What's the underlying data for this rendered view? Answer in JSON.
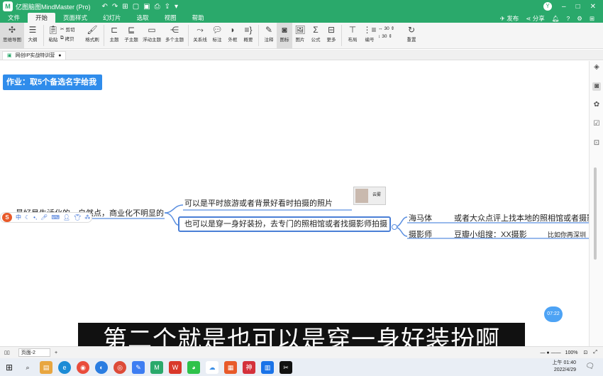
{
  "titlebar": {
    "app_title": "亿图脑图MindMaster (Pro)",
    "publish": "发布",
    "share": "分享",
    "user_initial": "Y"
  },
  "menu": {
    "tabs": [
      "文件",
      "开始",
      "页面样式",
      "幻灯片",
      "选取",
      "视图",
      "帮助"
    ],
    "active": "开始"
  },
  "ribbon": {
    "mindmap": "思维导图",
    "outline": "大纲",
    "paste": "粘贴",
    "cut": "剪切",
    "copy": "拷贝",
    "format_painter": "格式刷",
    "topic": "主题",
    "subtopic": "子主题",
    "floating_topic": "浮动主题",
    "multi_topic": "多个主题",
    "relation": "关系线",
    "callout": "标注",
    "boundary": "外框",
    "summary": "概要",
    "note": "注释",
    "icon": "图标",
    "image": "图片",
    "formula": "公式",
    "more": "更多",
    "layout": "布局",
    "numbering": "编号",
    "spacing_h": "30",
    "spacing_v": "30",
    "reset": "重置"
  },
  "doc_tab": {
    "name": "网创IP实战特训营"
  },
  "canvas": {
    "homework": "作业：取5个备选名字给我",
    "root_text": "最好是生活化的，自然点，商业化不明显的",
    "branch1": "可以是平时旅游或者背景好看时拍摄的照片",
    "branch2": "也可以是穿一身好装扮，去专门的照相馆或者找摄影师拍摄",
    "sub1": "海马体",
    "sub2": "摄影师",
    "sub1_detail": "或者大众点评上找本地的照相馆或者摄影",
    "sub2_detail": "豆瓣小组搜：XX摄影",
    "sub2_detail2": "比如你再深圳",
    "image_caption": "云雾",
    "subtitle": "第二个就是也可以是穿一身好装扮啊",
    "timer": "07:22",
    "floatbar_label": "中"
  },
  "statusbar": {
    "page": "页面-2",
    "zoom": "100%"
  },
  "taskbar": {
    "time": "上午 01:40",
    "date": "2022/4/29"
  },
  "colors": {
    "brand_green": "#2aa96b",
    "selection_blue": "#4a7fd6",
    "homework_blue": "#2f8ceb",
    "connector_blue": "#5b8fe0"
  }
}
